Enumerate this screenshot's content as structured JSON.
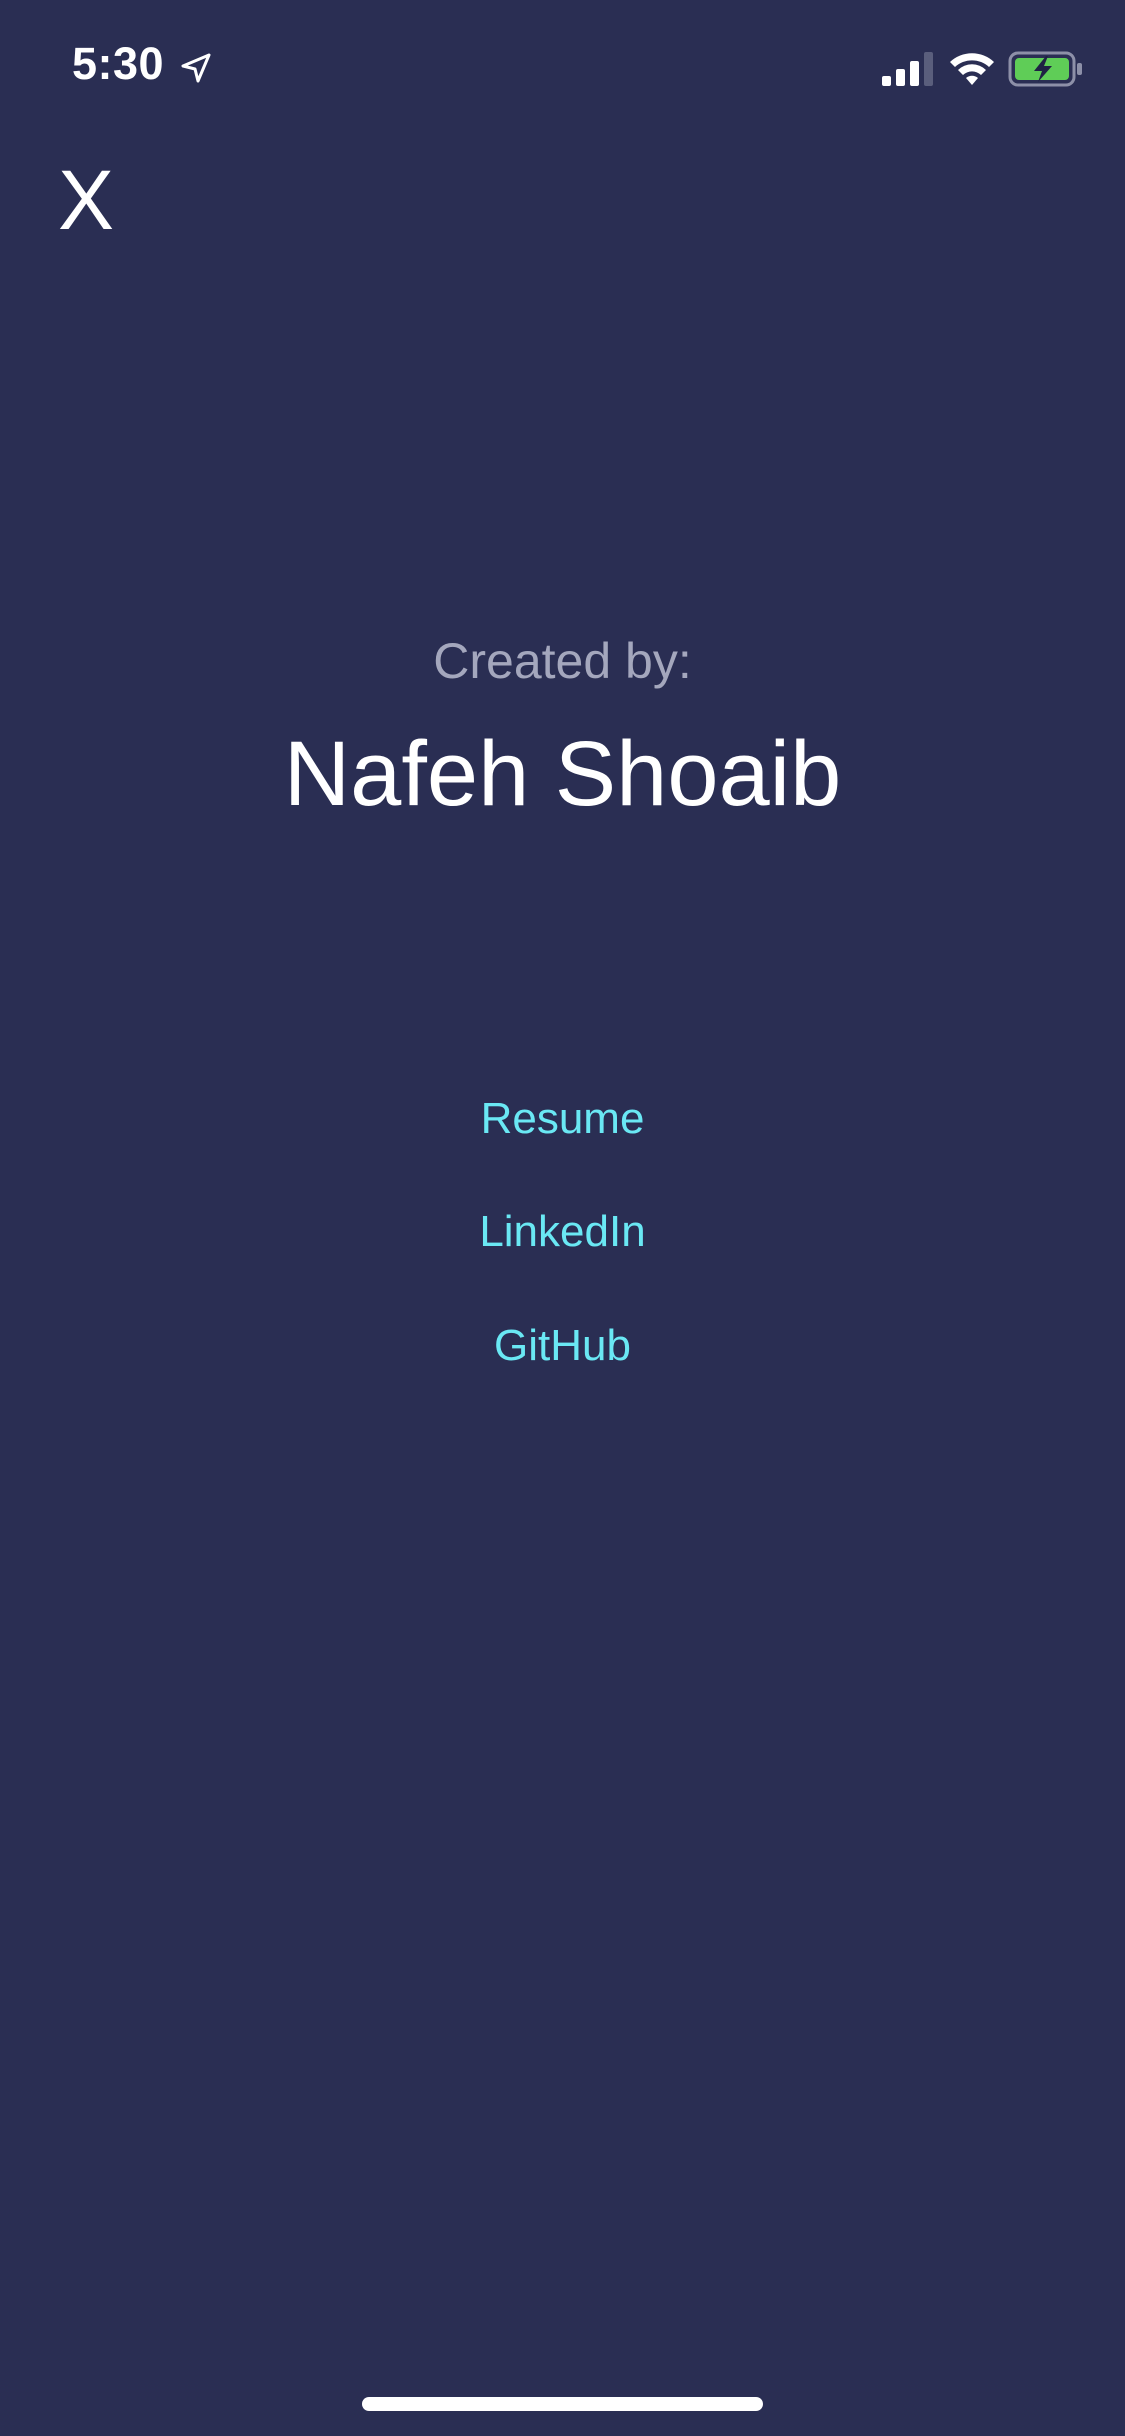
{
  "status_bar": {
    "time": "5:30",
    "icons": [
      "location-arrow-icon",
      "cellular-signal-icon",
      "wifi-icon",
      "battery-charging-icon"
    ],
    "battery_color": "#5fcd57"
  },
  "header": {
    "close_label": "X"
  },
  "credits": {
    "created_by_label": "Created by:",
    "author_name": "Nafeh Shoaib"
  },
  "links": {
    "resume": "Resume",
    "linkedin": "LinkedIn",
    "github": "GitHub"
  },
  "colors": {
    "background": "#2a2e53",
    "link": "#6ae8f4",
    "muted_text": "#a4a7bd",
    "primary_text": "#ffffff"
  }
}
